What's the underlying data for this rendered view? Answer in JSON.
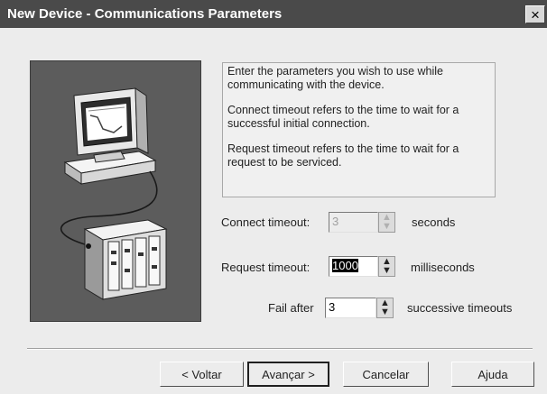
{
  "window": {
    "title": "New Device - Communications Parameters",
    "close_glyph": "×"
  },
  "info": {
    "paragraphs": [
      "Enter the parameters you wish to use while communicating with the device.",
      "Connect timeout refers to the time to wait for a successful initial connection.",
      "Request timeout refers to the time to wait for a request to be serviced."
    ]
  },
  "connect_timeout": {
    "label": "Connect timeout:",
    "value": "3",
    "unit": "seconds",
    "enabled": false
  },
  "request_timeout": {
    "label": "Request timeout:",
    "value": "1000",
    "unit": "milliseconds",
    "enabled": true
  },
  "fail_after": {
    "label": "Fail after",
    "value": "3",
    "unit": "successive timeouts",
    "enabled": true
  },
  "spinner": {
    "up": "▲",
    "down": "▼"
  },
  "buttons": {
    "back": "< Voltar",
    "next": "Avançar >",
    "cancel": "Cancelar",
    "help": "Ajuda"
  },
  "icons": [
    "computer-monitor-icon",
    "plc-device-icon",
    "close-icon"
  ]
}
